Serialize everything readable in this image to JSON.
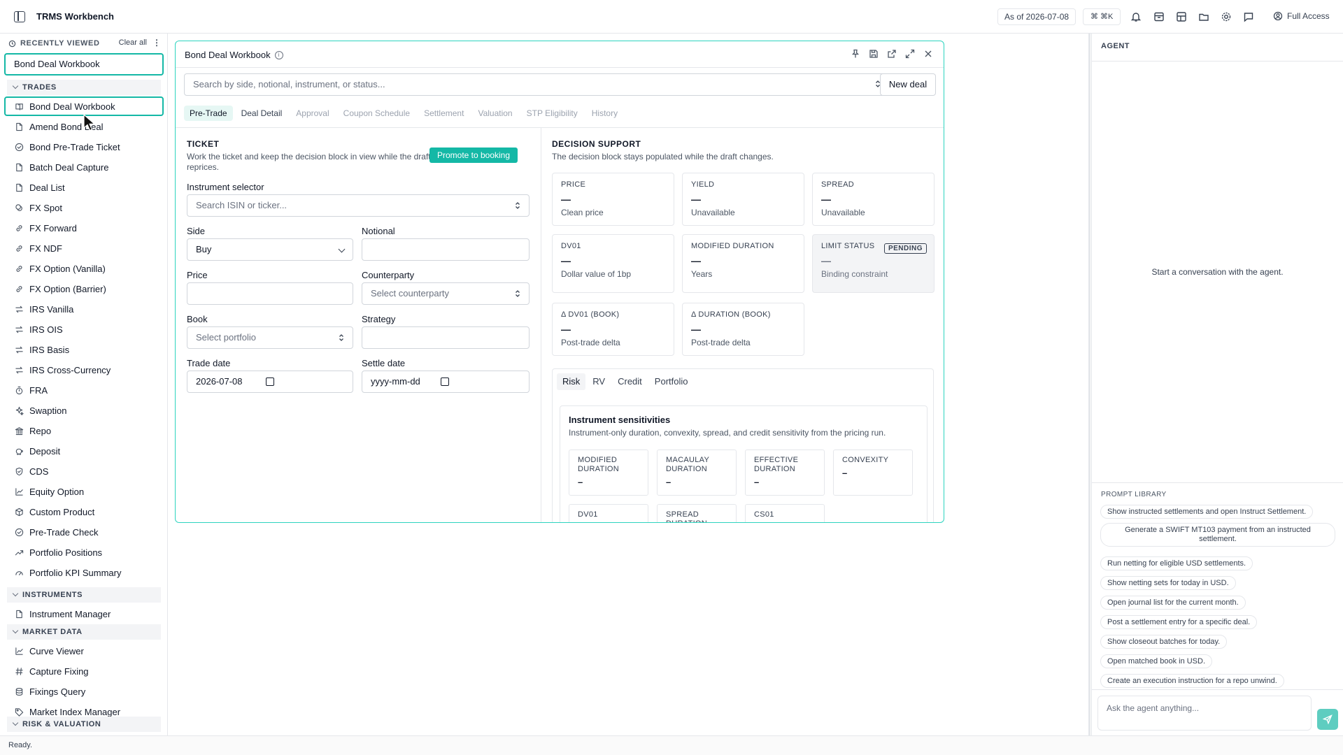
{
  "app": {
    "title": "TRMS Workbench",
    "as_of": "As of 2026-07-08",
    "shortcut": "⌘ ⌘K",
    "access": "Full Access"
  },
  "sidebar": {
    "recently_viewed_label": "RECENTLY VIEWED",
    "clear_all": "Clear all",
    "more": "⋮",
    "recent_item": "Bond Deal Workbook",
    "sections": {
      "trades": "TRADES",
      "instruments": "INSTRUMENTS",
      "market_data": "MARKET DATA",
      "risk": "RISK & VALUATION"
    },
    "trades": [
      {
        "label": "Bond Deal Workbook",
        "icon": "book-icon"
      },
      {
        "label": "Amend Bond Deal",
        "icon": "doc-icon"
      },
      {
        "label": "Bond Pre-Trade Ticket",
        "icon": "check-circle-icon"
      },
      {
        "label": "Batch Deal Capture",
        "icon": "doc-icon"
      },
      {
        "label": "Deal List",
        "icon": "doc-icon"
      },
      {
        "label": "FX Spot",
        "icon": "coins-icon"
      },
      {
        "label": "FX Forward",
        "icon": "link-icon"
      },
      {
        "label": "FX NDF",
        "icon": "link-icon"
      },
      {
        "label": "FX Option (Vanilla)",
        "icon": "link-icon"
      },
      {
        "label": "FX Option (Barrier)",
        "icon": "link-icon"
      },
      {
        "label": "IRS Vanilla",
        "icon": "swap-icon"
      },
      {
        "label": "IRS OIS",
        "icon": "swap-icon"
      },
      {
        "label": "IRS Basis",
        "icon": "swap-icon"
      },
      {
        "label": "IRS Cross-Currency",
        "icon": "swap-icon"
      },
      {
        "label": "FRA",
        "icon": "timer-icon"
      },
      {
        "label": "Swaption",
        "icon": "sparkle-icon"
      },
      {
        "label": "Repo",
        "icon": "bank-icon"
      },
      {
        "label": "Deposit",
        "icon": "piggy-icon"
      },
      {
        "label": "CDS",
        "icon": "shield-icon"
      },
      {
        "label": "Equity Option",
        "icon": "chart-icon"
      },
      {
        "label": "Custom Product",
        "icon": "box-icon"
      },
      {
        "label": "Pre-Trade Check",
        "icon": "check-circle-icon"
      },
      {
        "label": "Portfolio Positions",
        "icon": "trend-icon"
      },
      {
        "label": "Portfolio KPI Summary",
        "icon": "gauge-icon"
      }
    ],
    "instruments": [
      {
        "label": "Instrument Manager",
        "icon": "doc-icon"
      }
    ],
    "market_data": [
      {
        "label": "Curve Viewer",
        "icon": "chart-icon"
      },
      {
        "label": "Capture Fixing",
        "icon": "hash-icon"
      },
      {
        "label": "Fixings Query",
        "icon": "db-icon"
      },
      {
        "label": "Market Index Manager",
        "icon": "tag-icon"
      }
    ]
  },
  "status": "Ready.",
  "panel": {
    "title": "Bond Deal Workbook",
    "search_placeholder": "Search by side, notional, instrument, or status...",
    "new_deal": "New deal",
    "tabs": [
      "Pre-Trade",
      "Deal Detail",
      "Approval",
      "Coupon Schedule",
      "Settlement",
      "Valuation",
      "STP Eligibility",
      "History"
    ],
    "ticket": {
      "heading": "TICKET",
      "sub": "Work the ticket and keep the decision block in view while the draft reprices.",
      "promote": "Promote to booking",
      "instrument_label": "Instrument selector",
      "instrument_placeholder": "Search ISIN or ticker...",
      "side_label": "Side",
      "side_value": "Buy",
      "notional_label": "Notional",
      "price_label": "Price",
      "counterparty_label": "Counterparty",
      "counterparty_placeholder": "Select counterparty",
      "book_label": "Book",
      "book_placeholder": "Select portfolio",
      "strategy_label": "Strategy",
      "trade_date_label": "Trade date",
      "trade_date_value": "2026-07-08",
      "settle_date_label": "Settle date",
      "settle_date_placeholder": "yyyy-mm-dd"
    },
    "decision": {
      "heading": "DECISION SUPPORT",
      "sub": "The decision block stays populated while the draft changes.",
      "cards": [
        {
          "label": "PRICE",
          "value": "—",
          "sub": "Clean price"
        },
        {
          "label": "YIELD",
          "value": "—",
          "sub": "Unavailable"
        },
        {
          "label": "SPREAD",
          "value": "—",
          "sub": "Unavailable"
        },
        {
          "label": "DV01",
          "value": "—",
          "sub": "Dollar value of 1bp"
        },
        {
          "label": "MODIFIED DURATION",
          "value": "—",
          "sub": "Years"
        },
        {
          "label": "LIMIT STATUS",
          "value": "—",
          "sub": "Binding constraint",
          "badge": "PENDING"
        },
        {
          "label": "Δ DV01 (BOOK)",
          "value": "—",
          "sub": "Post-trade delta"
        },
        {
          "label": "Δ DURATION (BOOK)",
          "value": "—",
          "sub": "Post-trade delta"
        }
      ],
      "subtabs": [
        "Risk",
        "RV",
        "Credit",
        "Portfolio"
      ],
      "sens_title": "Instrument sensitivities",
      "sens_sub": "Instrument-only duration, convexity, spread, and credit sensitivity from the pricing run.",
      "sens_cards": [
        {
          "label": "MODIFIED DURATION",
          "value": "–"
        },
        {
          "label": "MACAULAY DURATION",
          "value": "–"
        },
        {
          "label": "EFFECTIVE DURATION",
          "value": "–"
        },
        {
          "label": "CONVEXITY",
          "value": "–"
        },
        {
          "label": "DV01",
          "value": ""
        },
        {
          "label": "SPREAD DURATION",
          "value": ""
        },
        {
          "label": "CS01",
          "value": ""
        }
      ]
    }
  },
  "agent": {
    "heading": "AGENT",
    "empty": "Start a conversation with the agent.",
    "prompt_library": "PROMPT LIBRARY",
    "prompts": [
      "Show instructed settlements and open Instruct Settlement.",
      "Generate a SWIFT MT103 payment from an instructed settlement.",
      "Run netting for eligible USD settlements.",
      "Show netting sets for today in USD.",
      "Open journal list for the current month.",
      "Post a settlement entry for a specific deal.",
      "Show closeout batches for today.",
      "Open matched book in USD.",
      "Create an execution instruction for a repo unwind."
    ],
    "ask_placeholder": "Ask the agent anything..."
  }
}
